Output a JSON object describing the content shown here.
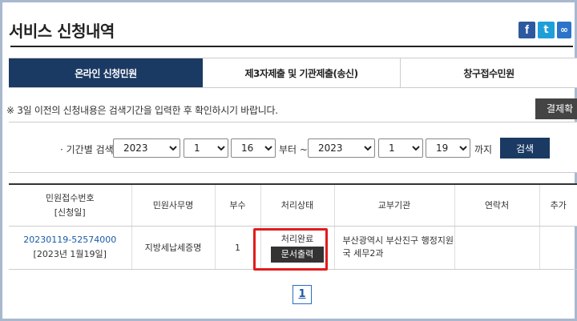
{
  "header": {
    "title": "서비스 신청내역",
    "share": {
      "facebook": "f",
      "twitter": "t",
      "link": "∞"
    }
  },
  "tabs": [
    {
      "label": "온라인 신청민원",
      "active": true
    },
    {
      "label": "제3자제출 및 기관제출(송신)",
      "active": false
    },
    {
      "label": "창구접수민원",
      "active": false
    }
  ],
  "notice": {
    "text": "※ 3일 이전의 신청내용은 검색기간을 입력한 후 확인하시기 바랍니다.",
    "pay_button": "결제확"
  },
  "search": {
    "label": "· 기간별 검색",
    "start": {
      "year": "2023",
      "month": "1",
      "day": "16"
    },
    "from_label": "부터 ~",
    "end": {
      "year": "2023",
      "month": "1",
      "day": "19"
    },
    "to_label": "까지",
    "button": "검색"
  },
  "table": {
    "headers": [
      "민원접수번호\n[신청일]",
      "민원사무명",
      "부수",
      "처리상태",
      "교부기관",
      "연락처",
      "추가"
    ],
    "header_line1": "민원접수번호",
    "header_line2": "[신청일]",
    "rows": [
      {
        "receipt_no": "20230119-52574000",
        "date": "[2023년 1월19일]",
        "service": "지방세납세증명",
        "copies": "1",
        "status": "처리완료",
        "print_button": "문서출력",
        "agency": "부산광역시 부산진구 행정지원국 세무2과",
        "contact": "",
        "extra": ""
      }
    ]
  },
  "pagination": {
    "current": "1"
  },
  "colors": {
    "navy": "#1b3a63",
    "highlight": "#e01c1c",
    "link": "#1a5aa8"
  }
}
